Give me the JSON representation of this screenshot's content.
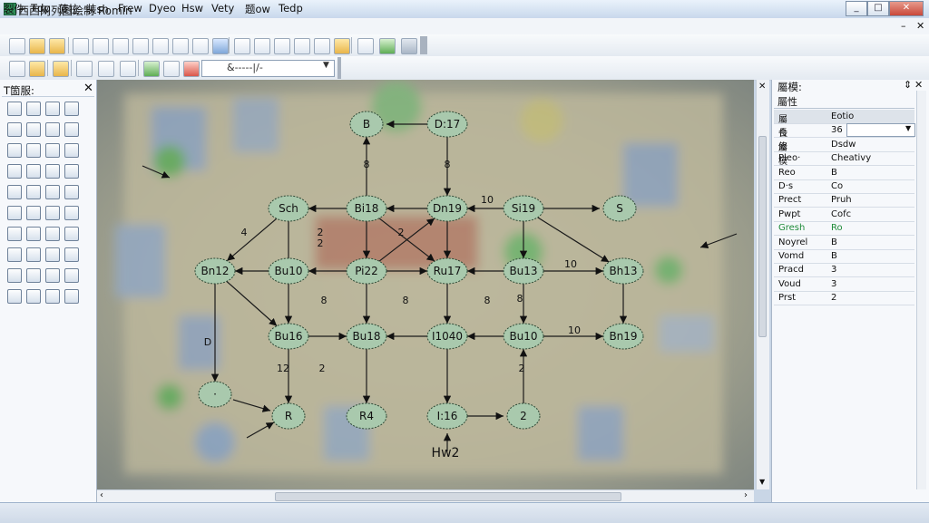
{
  "window": {
    "title": "西西网列图绘制 Romin",
    "minimize": "_",
    "maximize": "□",
    "close": "✕"
  },
  "menu": [
    "裂件",
    "Tdp",
    "菠拉",
    "装sh",
    "Frew",
    "Dyeo",
    "Hsw",
    "Vety",
    "题ow",
    "Tedp"
  ],
  "view_combo": {
    "value": "&-----|/-"
  },
  "left_panel": {
    "title": "T箇服:",
    "close": "✕"
  },
  "properties": {
    "title": "屬模:",
    "pin": "⇕",
    "close": "✕",
    "header": "屬性",
    "rows": [
      {
        "key": "屬長",
        "value": "Eotio"
      },
      {
        "key": "合修",
        "value": "36"
      },
      {
        "key": "屬模",
        "value": "Dsdw"
      },
      {
        "key": "Pleo·",
        "value": "Cheativy"
      },
      {
        "key": "Reo",
        "value": "B"
      },
      {
        "key": "D·s",
        "value": "Co"
      },
      {
        "key": "Prect",
        "value": "Pruh"
      },
      {
        "key": "Pwpt",
        "value": "Cofc"
      },
      {
        "key": "Gresh",
        "value": "Ro",
        "highlight": true
      },
      {
        "key": "Noyrel",
        "value": "B"
      },
      {
        "key": "Vomd",
        "value": "B"
      },
      {
        "key": "Pracd",
        "value": "3"
      },
      {
        "key": "Voud",
        "value": "3"
      },
      {
        "key": "Prst",
        "value": "2"
      }
    ]
  },
  "graph": {
    "nodes": [
      {
        "id": "B",
        "label": "B"
      },
      {
        "id": "D17",
        "label": "D:17"
      },
      {
        "id": "Sch",
        "label": "Sch"
      },
      {
        "id": "Bi18",
        "label": "Bi18"
      },
      {
        "id": "Dn19",
        "label": "Dn19"
      },
      {
        "id": "Si19",
        "label": "Si19"
      },
      {
        "id": "S",
        "label": "S"
      },
      {
        "id": "Bn12",
        "label": "Bn12"
      },
      {
        "id": "Bu10",
        "label": "Bu10"
      },
      {
        "id": "Pi22",
        "label": "Pi22"
      },
      {
        "id": "Ru17",
        "label": "Ru17"
      },
      {
        "id": "Bu13",
        "label": "Bu13"
      },
      {
        "id": "Bh13",
        "label": "Bh13"
      },
      {
        "id": "Bu16",
        "label": "Bu16"
      },
      {
        "id": "Bu18",
        "label": "Bu18"
      },
      {
        "id": "I1040",
        "label": "I1040"
      },
      {
        "id": "Bu10b",
        "label": "Bu10"
      },
      {
        "id": "Bn19",
        "label": "Bn19"
      },
      {
        "id": "Dot",
        "label": "·"
      },
      {
        "id": "R",
        "label": "R"
      },
      {
        "id": "R4",
        "label": "R4"
      },
      {
        "id": "I16",
        "label": "I:16"
      },
      {
        "id": "N2",
        "label": "2"
      }
    ],
    "edge_labels": [
      "8",
      "8",
      "10",
      "4",
      "2",
      "2",
      "2",
      "10",
      "8",
      "8",
      "8",
      "10",
      "D",
      "12",
      "2",
      "2",
      "8"
    ],
    "free_label": "Hw2"
  }
}
